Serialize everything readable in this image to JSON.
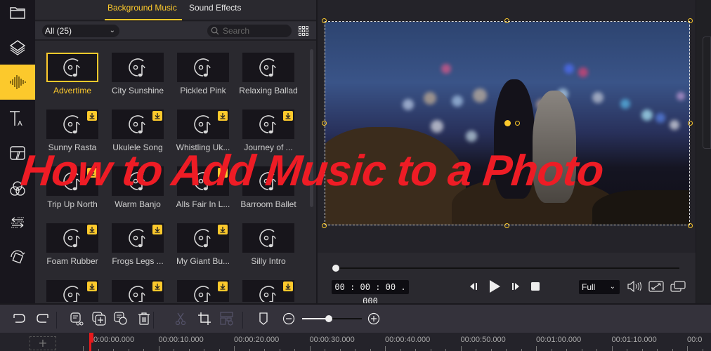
{
  "sidebar": {
    "items": [
      {
        "name": "media",
        "icon": "folder-icon"
      },
      {
        "name": "layers",
        "icon": "layers-icon"
      },
      {
        "name": "audio",
        "icon": "audio-wave-icon",
        "active": true
      },
      {
        "name": "text",
        "icon": "text-icon"
      },
      {
        "name": "transitions",
        "icon": "transition-icon"
      },
      {
        "name": "filters",
        "icon": "filters-icon"
      },
      {
        "name": "overlays",
        "icon": "overlay-icon"
      },
      {
        "name": "elements",
        "icon": "rotate-shape-icon"
      }
    ]
  },
  "library": {
    "tabs": [
      {
        "label": "Background Music",
        "active": true
      },
      {
        "label": "Sound Effects",
        "active": false
      }
    ],
    "filter": {
      "selected": "All (25)"
    },
    "search": {
      "placeholder": "Search"
    },
    "tracks": [
      {
        "title": "Advertime",
        "download": false,
        "selected": true
      },
      {
        "title": "City Sunshine",
        "download": false
      },
      {
        "title": "Pickled Pink",
        "download": false
      },
      {
        "title": "Relaxing Ballad",
        "download": false
      },
      {
        "title": "Sunny Rasta",
        "download": true
      },
      {
        "title": "Ukulele Song",
        "download": true
      },
      {
        "title": "Whistling Uk...",
        "download": true
      },
      {
        "title": "Journey of ...",
        "download": true
      },
      {
        "title": "Trip Up North",
        "download": true
      },
      {
        "title": "Warm Banjo",
        "download": false
      },
      {
        "title": "Alls Fair In L...",
        "download": true
      },
      {
        "title": "Barroom Ballet",
        "download": false
      },
      {
        "title": "Foam Rubber",
        "download": true
      },
      {
        "title": "Frogs Legs ...",
        "download": true
      },
      {
        "title": "My Giant Bu...",
        "download": true
      },
      {
        "title": "Silly Intro",
        "download": false
      },
      {
        "title": "",
        "download": true
      },
      {
        "title": "",
        "download": true
      },
      {
        "title": "",
        "download": true
      },
      {
        "title": "",
        "download": true
      }
    ]
  },
  "player": {
    "timecode": "00 : 00 : 00 . 000",
    "progress": 0,
    "quality": "Full"
  },
  "toolbar": {
    "zoom_level": 0.45
  },
  "timeline": {
    "add_track_label": "+",
    "ticks": [
      "0:00:00.000",
      "00:00:10.000",
      "00:00:20.000",
      "00:00:30.000",
      "00:00:40.000",
      "00:00:50.000",
      "00:01:00.000",
      "00:01:10.000",
      "00:0"
    ]
  },
  "overlay": {
    "title": "How to Add Music to a Photo"
  },
  "colors": {
    "accent": "#fcc92c",
    "overlay_text": "#ee1c25",
    "playhead": "#e8191c"
  }
}
